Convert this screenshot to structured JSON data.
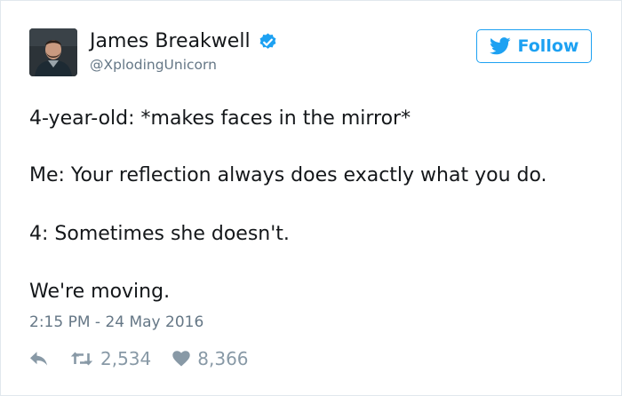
{
  "tweet": {
    "author_name": "James Breakwell",
    "author_handle": "@XplodingUnicorn",
    "follow_label": "Follow",
    "lines": [
      "4-year-old: *makes faces in the mirror*",
      "Me: Your reflection always does exactly what you do.",
      "4: Sometimes she doesn't.",
      "We're moving."
    ],
    "timestamp": "2:15 PM - 24 May 2016",
    "retweet_count": "2,534",
    "like_count": "8,366"
  },
  "icons": {
    "verified": "verified-badge-icon",
    "follow": "twitter-bird-icon",
    "reply": "reply-arrow-icon",
    "retweet": "retweet-icon",
    "like": "heart-icon"
  },
  "colors": {
    "accent": "#1da1f2",
    "secondary_text": "#657786",
    "action_icons": "#8899a6",
    "text": "#14171a"
  }
}
